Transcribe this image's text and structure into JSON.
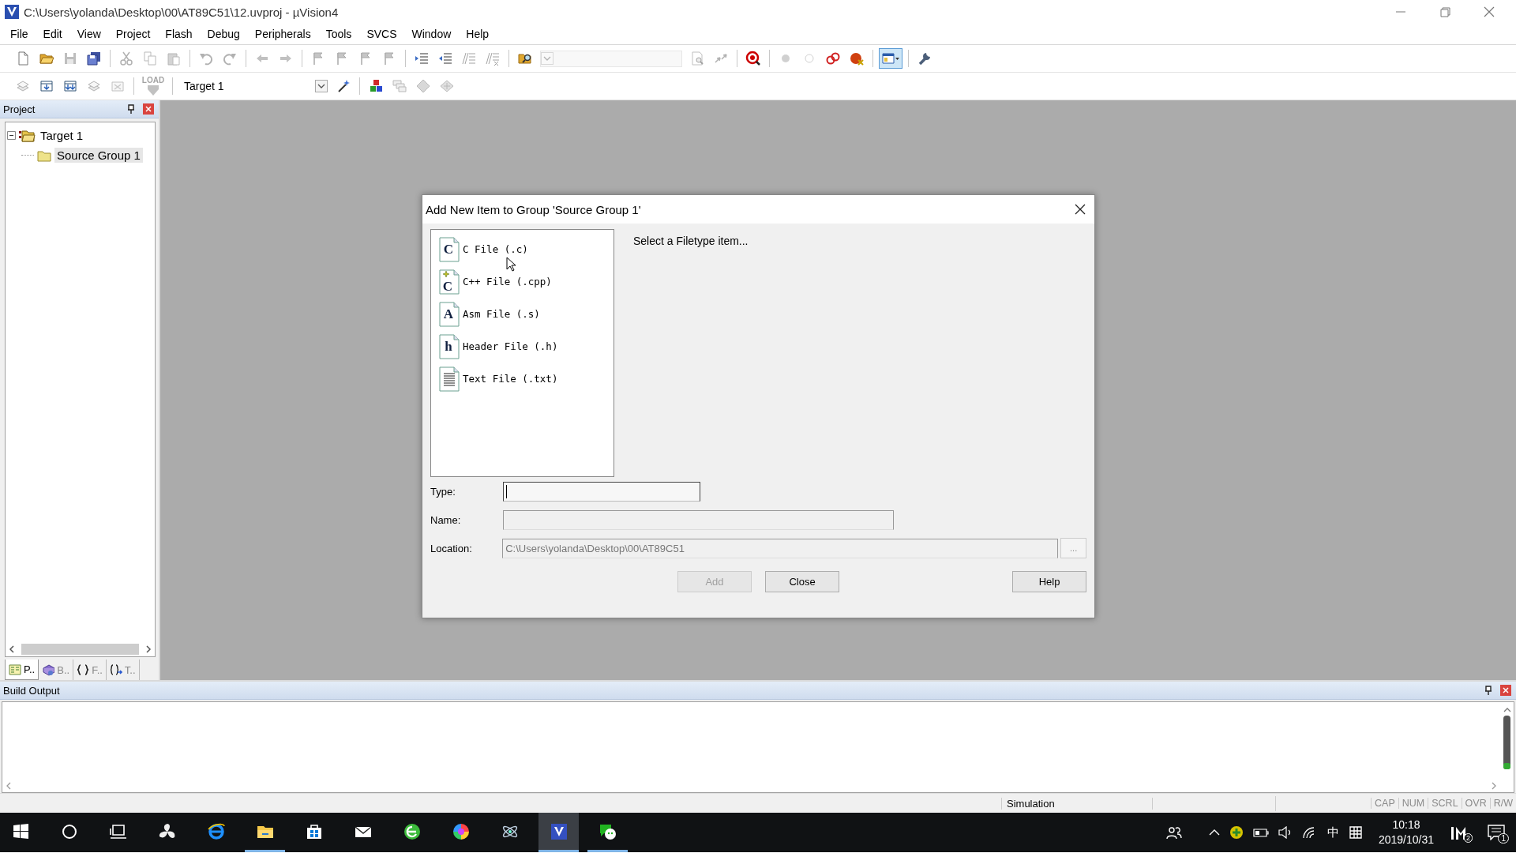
{
  "window": {
    "title": "C:\\Users\\yolanda\\Desktop\\00\\AT89C51\\12.uvproj - µVision4"
  },
  "menu": [
    "File",
    "Edit",
    "View",
    "Project",
    "Flash",
    "Debug",
    "Peripherals",
    "Tools",
    "SVCS",
    "Window",
    "Help"
  ],
  "toolbar_1": [
    {
      "kind": "new",
      "disabled": false,
      "pressed": false
    },
    {
      "kind": "open",
      "disabled": false,
      "pressed": false
    },
    {
      "kind": "save",
      "disabled": true,
      "pressed": false
    },
    {
      "kind": "saveall",
      "disabled": false,
      "pressed": false
    },
    {
      "kind": "separator"
    },
    {
      "kind": "cut",
      "disabled": true,
      "pressed": false
    },
    {
      "kind": "copy",
      "disabled": true,
      "pressed": false
    },
    {
      "kind": "paste",
      "disabled": true,
      "pressed": false
    },
    {
      "kind": "separator"
    },
    {
      "kind": "undo",
      "disabled": true,
      "pressed": false
    },
    {
      "kind": "redo",
      "disabled": true,
      "pressed": false
    },
    {
      "kind": "separator"
    },
    {
      "kind": "back",
      "disabled": true,
      "pressed": false
    },
    {
      "kind": "forward",
      "disabled": true,
      "pressed": false
    },
    {
      "kind": "separator"
    },
    {
      "kind": "bookmark",
      "disabled": true,
      "pressed": false
    },
    {
      "kind": "bookmark",
      "disabled": true,
      "pressed": false
    },
    {
      "kind": "bookmark",
      "disabled": true,
      "pressed": false
    },
    {
      "kind": "bookmark",
      "disabled": true,
      "pressed": false
    },
    {
      "kind": "separator"
    },
    {
      "kind": "indent",
      "disabled": false,
      "pressed": false
    },
    {
      "kind": "unindent",
      "disabled": false,
      "pressed": false
    },
    {
      "kind": "comment",
      "disabled": true,
      "pressed": false
    },
    {
      "kind": "uncomment",
      "disabled": true,
      "pressed": false
    },
    {
      "kind": "separator"
    },
    {
      "kind": "findfiles",
      "disabled": false,
      "pressed": false
    },
    {
      "kind": "combo",
      "disabled": true
    },
    {
      "kind": "find",
      "disabled": true,
      "pressed": false
    },
    {
      "kind": "incfind",
      "disabled": true,
      "pressed": false
    },
    {
      "kind": "separator"
    },
    {
      "kind": "debug",
      "disabled": false,
      "pressed": false
    },
    {
      "kind": "separator"
    },
    {
      "kind": "bp",
      "disabled": true,
      "pressed": false
    },
    {
      "kind": "bpempty",
      "disabled": true,
      "pressed": false
    },
    {
      "kind": "bpdisable",
      "disabled": false,
      "pressed": false
    },
    {
      "kind": "bpkill",
      "disabled": false,
      "pressed": false
    },
    {
      "kind": "separator"
    },
    {
      "kind": "windows",
      "disabled": false,
      "pressed": true
    },
    {
      "kind": "separator"
    },
    {
      "kind": "wrench",
      "disabled": false,
      "pressed": false
    }
  ],
  "toolbar_2": [
    {
      "kind": "translate",
      "disabled": true,
      "pressed": false
    },
    {
      "kind": "build",
      "disabled": false,
      "pressed": false
    },
    {
      "kind": "rebuild",
      "disabled": false,
      "pressed": false
    },
    {
      "kind": "translate",
      "disabled": true,
      "pressed": false
    },
    {
      "kind": "stop",
      "disabled": true,
      "pressed": false
    },
    {
      "kind": "separator"
    },
    {
      "kind": "download",
      "glyph": "LOAD",
      "disabled": true,
      "pressed": false
    },
    {
      "kind": "separator"
    },
    {
      "kind": "combo",
      "value": "Target 1",
      "disabled": false
    },
    {
      "kind": "wand",
      "disabled": false,
      "pressed": false
    },
    {
      "kind": "separator"
    },
    {
      "kind": "manage",
      "disabled": false,
      "pressed": false
    },
    {
      "kind": "packs",
      "disabled": true,
      "pressed": false
    },
    {
      "kind": "diamond",
      "disabled": true,
      "pressed": false
    },
    {
      "kind": "templates",
      "disabled": true,
      "pressed": false
    }
  ],
  "project": {
    "title": "Project",
    "tree": [
      {
        "label": "Target 1",
        "kind": "target",
        "expanded": true,
        "selected": false,
        "children": [
          {
            "label": "Source Group 1",
            "kind": "group",
            "selected": true
          }
        ]
      }
    ],
    "tabs": [
      {
        "label": "P..",
        "kind": "project",
        "selected": true
      },
      {
        "label": "B..",
        "kind": "books",
        "selected": false
      },
      {
        "label": "F..",
        "kind": "functions",
        "selected": false
      },
      {
        "label": "T..",
        "kind": "templates",
        "selected": false
      }
    ]
  },
  "dialog": {
    "title": "Add New Item to Group 'Source Group 1'",
    "file_types": [
      {
        "kind": "c",
        "glyph": "C",
        "label": "C File (.c)",
        "selected": false
      },
      {
        "kind": "cpp",
        "glyph": "C",
        "label": "C++ File (.cpp)",
        "selected": false
      },
      {
        "kind": "asm",
        "glyph": "A",
        "label": "Asm File (.s)",
        "selected": false
      },
      {
        "kind": "header",
        "glyph": "h",
        "label": "Header File (.h)",
        "selected": false
      },
      {
        "kind": "text",
        "label": "Text File (.txt)",
        "selected": false
      }
    ],
    "description": "Select a Filetype item...",
    "fields": [
      {
        "label": "Type:",
        "kind": "short",
        "focused": true
      },
      {
        "label": "Name:",
        "kind": "medium",
        "focused": false
      },
      {
        "label": "Location:",
        "kind": "long",
        "value": "C:\\Users\\yolanda\\Desktop\\00\\AT89C51",
        "focused": false
      }
    ],
    "browse": "...",
    "buttons": [
      {
        "label": "Add",
        "disabled": true
      },
      {
        "label": "Close",
        "disabled": false
      },
      {
        "label": "Help",
        "disabled": false
      }
    ]
  },
  "build_output": {
    "title": "Build Output"
  },
  "status_bar": {
    "mode": "Simulation",
    "indicators": [
      {
        "label": "CAP",
        "active": false
      },
      {
        "label": "NUM",
        "active": false
      },
      {
        "label": "SCRL",
        "active": false
      },
      {
        "label": "OVR",
        "active": false
      },
      {
        "label": "R/W",
        "active": false
      }
    ]
  },
  "taskbar": {
    "apps": [
      {
        "kind": "start",
        "running": false,
        "selected": false
      },
      {
        "kind": "search",
        "running": false,
        "selected": false
      },
      {
        "kind": "taskview",
        "running": false,
        "selected": false
      },
      {
        "kind": "fan",
        "running": false,
        "selected": false
      },
      {
        "kind": "ie",
        "running": false,
        "selected": false
      },
      {
        "kind": "explorer",
        "running": true,
        "selected": false
      },
      {
        "kind": "store",
        "running": false,
        "selected": false
      },
      {
        "kind": "mail",
        "running": false,
        "selected": false
      },
      {
        "kind": "greenbrowser",
        "running": false,
        "selected": false
      },
      {
        "kind": "colorwheel",
        "running": false,
        "selected": false
      },
      {
        "kind": "atom",
        "running": false,
        "selected": false
      },
      {
        "kind": "uvision",
        "running": true,
        "selected": true
      },
      {
        "kind": "chat",
        "running": true,
        "selected": false
      }
    ],
    "ime": "中",
    "time": "10:18",
    "date": "2019/10/31",
    "im_badge": "2",
    "notifications": "1"
  }
}
